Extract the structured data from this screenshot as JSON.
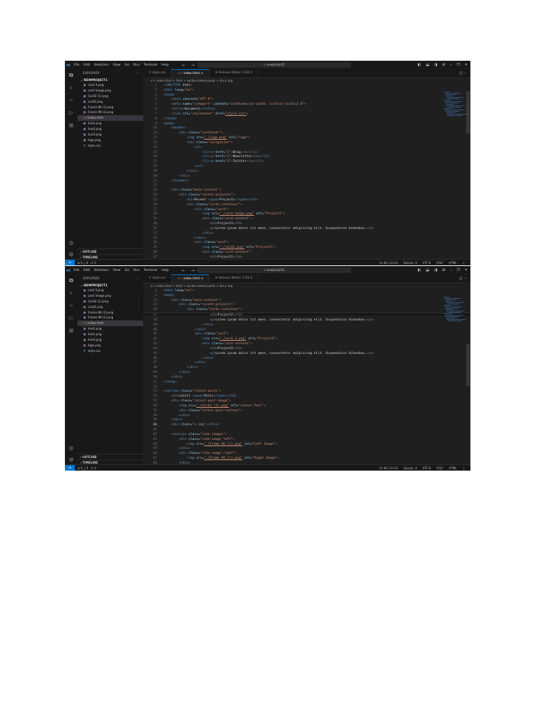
{
  "windows": [
    {
      "menu": [
        "File",
        "Edit",
        "Selection",
        "View",
        "Go",
        "Run",
        "Terminal",
        "Help"
      ],
      "search": "newproject1",
      "explorer_title": "EXPLORER",
      "project": "NEWPROJECT1",
      "files": [
        {
          "name": "card 3.png",
          "kind": "img"
        },
        {
          "name": "card image.png",
          "kind": "img"
        },
        {
          "name": "Card2 (1).png",
          "kind": "img"
        },
        {
          "name": "card2.png",
          "kind": "img"
        },
        {
          "name": "Frame 86 (1).png",
          "kind": "img"
        },
        {
          "name": "Frame 99 (1).png",
          "kind": "img"
        },
        {
          "name": "index.html",
          "kind": "html",
          "selected": true
        },
        {
          "name": "line1.png",
          "kind": "img"
        },
        {
          "name": "line2.png",
          "kind": "img"
        },
        {
          "name": "line3.png",
          "kind": "img"
        },
        {
          "name": "logo.png",
          "kind": "img"
        },
        {
          "name": "style.css",
          "kind": "css"
        }
      ],
      "outline": "OUTLINE",
      "timeline": "TIMELINE",
      "tabs": [
        {
          "label": "style.css",
          "icon": "#"
        },
        {
          "label": "index.html",
          "icon": "<>",
          "active": true,
          "close": "×"
        },
        {
          "label": "Release Notes: 1.92.0",
          "icon": "≡"
        }
      ],
      "breadcrumb": "index.html > html > section.latest-posts > div.s.img",
      "sticky": [],
      "current_line": 0,
      "lines": [
        [
          1,
          "<!DOCTYPE html>"
        ],
        [
          2,
          "<html lang=\"en\">"
        ],
        [
          3,
          "<head>"
        ],
        [
          4,
          "    <meta charset=\"UTF-8\">"
        ],
        [
          5,
          "    <meta name=\"viewport\" content=\"width=device-width, initial-scale=1.0\">"
        ],
        [
          6,
          "    <title>Document</title>"
        ],
        [
          7,
          "    <link rel=\"stylesheet\" href=\"style.css\">"
        ],
        [
          8,
          "</head>"
        ],
        [
          9,
          "<body>"
        ],
        [
          10,
          "    <header>"
        ],
        [
          11,
          "        <div class=\"container\">"
        ],
        [
          12,
          "            <img src=\"./logo.png\" alt=\"logo\">"
        ],
        [
          13,
          "            <nav class=\"navigation\">"
        ],
        [
          14,
          "                <ul>"
        ],
        [
          15,
          "                    <li><a href=\"1\">Blog</a></li>"
        ],
        [
          16,
          "                    <li><a href=\"2\">Newsletter</a></li>"
        ],
        [
          17,
          "                    <li><a href=\"3\">Twitter</a></li>"
        ],
        [
          18,
          "                </ul>"
        ],
        [
          19,
          "            </nav>"
        ],
        [
          20,
          "        </div>"
        ],
        [
          21,
          "    </header>"
        ],
        [
          22,
          ""
        ],
        [
          23,
          "    <div class=\"main-content\">"
        ],
        [
          24,
          "        <div class=\"recent-projects\">"
        ],
        [
          25,
          "            <h2>Recent <span>Projects</span></h2>"
        ],
        [
          26,
          "            <div class=\"cards-container\">"
        ],
        [
          27,
          "                <div class=\"card\">"
        ],
        [
          28,
          "                    <img src=\"./card image.png\" alt=\"Project1\">"
        ],
        [
          29,
          "                    <div class=\"card-content\">"
        ],
        [
          30,
          "                        <h3>Project1</h3>"
        ],
        [
          31,
          "                        <p>Lorem ipsum dolor sit amet, consectetur adipiscing elit. Suspendisse bibendum.</p>"
        ],
        [
          32,
          "                    </div>"
        ],
        [
          33,
          "                </div>"
        ],
        [
          34,
          "                <div class=\"card\">"
        ],
        [
          35,
          "                    <img src=\"./card2.png\" alt=\"Project2\">"
        ],
        [
          36,
          "                    <div class=\"card-content\">"
        ],
        [
          37,
          "                        <h3>Project2</h3>"
        ]
      ],
      "status": {
        "errors": "⊗ 0 △ 0",
        "ports": "⊮ 0",
        "position": "Ln 60, Col 22",
        "spaces": "Spaces: 4",
        "encoding": "UTF-8",
        "eol": "CRLF",
        "lang": "HTML",
        "bell": "♫"
      }
    },
    {
      "menu": [
        "File",
        "Edit",
        "Selection",
        "View",
        "Go",
        "Run",
        "Terminal",
        "Help"
      ],
      "search": "newproject1",
      "explorer_title": "EXPLORER",
      "project": "NEWPROJECT1",
      "files": [
        {
          "name": "card 3.png",
          "kind": "img"
        },
        {
          "name": "card image.png",
          "kind": "img"
        },
        {
          "name": "Card2 (1).png",
          "kind": "img"
        },
        {
          "name": "card2.png",
          "kind": "img"
        },
        {
          "name": "Frame 86 (1).png",
          "kind": "img"
        },
        {
          "name": "Frame 99 (1).png",
          "kind": "img"
        },
        {
          "name": "index.html",
          "kind": "html",
          "selected": true
        },
        {
          "name": "line1.png",
          "kind": "img"
        },
        {
          "name": "line2.png",
          "kind": "img"
        },
        {
          "name": "line3.png",
          "kind": "img"
        },
        {
          "name": "logo.png",
          "kind": "img"
        },
        {
          "name": "style.css",
          "kind": "css"
        }
      ],
      "outline": "OUTLINE",
      "timeline": "TIMELINE",
      "tabs": [
        {
          "label": "style.css",
          "icon": "#"
        },
        {
          "label": "index.html",
          "icon": "<>",
          "active": true,
          "close": "×"
        },
        {
          "label": "Release Notes: 1.92.0",
          "icon": "≡"
        }
      ],
      "breadcrumb": "index.html > html > section.latest-posts > div.s.img",
      "sticky": [
        [
          2,
          "<html lang=\"en\">"
        ],
        [
          3,
          "<body>"
        ],
        [
          23,
          "    <div class=\"main-content\">"
        ],
        [
          24,
          "        <div class=\"recent-projects\">"
        ],
        [
          26,
          "            <div class=\"cards-container\">"
        ]
      ],
      "current_line": 60,
      "lines": [
        [
          37,
          "                        <h3>Project2</h3>"
        ],
        [
          38,
          "                        <p>Lorem ipsum dolor sit amet, consectetur adipiscing elit. Suspendisse bibendum.</p>"
        ],
        [
          39,
          "                    </div>"
        ],
        [
          40,
          "                </div>"
        ],
        [
          41,
          "                <div class=\"card\">"
        ],
        [
          42,
          "                    <img src=\"./card 3.png\" alt=\"Project3\">"
        ],
        [
          43,
          "                    <div class=\"card-content\">"
        ],
        [
          44,
          "                        <h3>Project3</h3>"
        ],
        [
          45,
          "                        <p>Lorem ipsum dolor sit amet, consectetur adipiscing elit. Suspendisse bibendum.</p>"
        ],
        [
          46,
          "                    </div>"
        ],
        [
          47,
          "                </div>"
        ],
        [
          48,
          "            </div>"
        ],
        [
          49,
          "        </div>"
        ],
        [
          50,
          "    </div>"
        ],
        [
          51,
          "</body>"
        ],
        [
          52,
          ""
        ],
        [
          53,
          "<section class=\"latest-posts\">"
        ],
        [
          54,
          "    <h2>Latest <span>Posts</span></h2>"
        ],
        [
          55,
          "    <div class=\"latest-post-image\">"
        ],
        [
          56,
          "        <img src=\"./Card2 (1).png\" alt=\"Latest Post\">"
        ],
        [
          57,
          "        <div class=\"latest-post-content\">"
        ],
        [
          58,
          "        </div>"
        ],
        [
          59,
          "    </div>"
        ],
        [
          60,
          "    <div class=\"s.img\"></div>"
        ],
        [
          61,
          ""
        ],
        [
          62,
          "    <section class=\"side-images\">"
        ],
        [
          63,
          "        <div class=\"side-image left\">"
        ],
        [
          64,
          "            <img src=\"./Frame 86 (1).png\" alt=\"Left Image\">"
        ],
        [
          65,
          "        </div>"
        ],
        [
          66,
          "        <div class=\"side-image right\">"
        ],
        [
          67,
          "            <img src=\"./Frame 99 (1).png\" alt=\"Right Image\">"
        ],
        [
          68,
          "        </div>"
        ]
      ],
      "status": {
        "errors": "⊗ 0 △ 0",
        "ports": "⊮ 0",
        "position": "Ln 60, Col 22",
        "spaces": "Spaces: 4",
        "encoding": "UTF-8",
        "eol": "CRLF",
        "lang": "HTML",
        "bell": "♫"
      }
    }
  ],
  "colors": {
    "accent": "#0078d4",
    "tag": "#569cd6",
    "attr": "#9cdcfe",
    "string": "#ce9178"
  }
}
